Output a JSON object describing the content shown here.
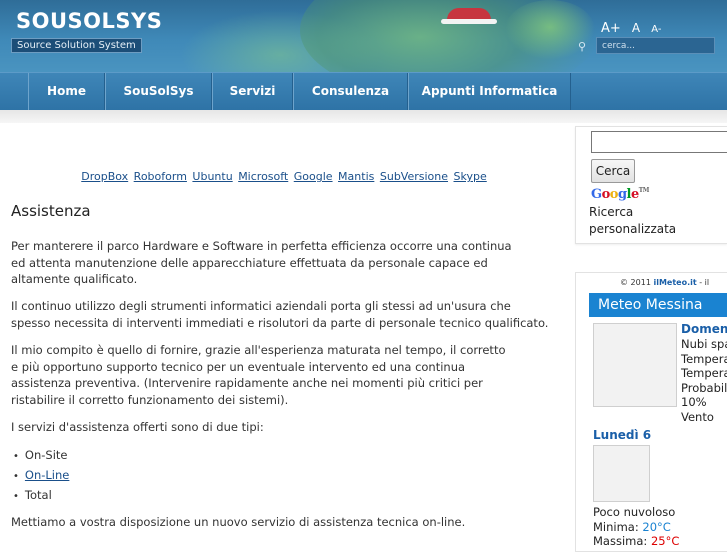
{
  "header": {
    "site_title": "SOUSOLSYS",
    "tagline": "Source Solution System",
    "font_tools": {
      "increase": "A+",
      "normal": "A",
      "decrease": "A-"
    },
    "search_placeholder": "cerca..."
  },
  "nav": {
    "items": [
      {
        "label": "Home"
      },
      {
        "label": "SouSolSys"
      },
      {
        "label": "Servizi"
      },
      {
        "label": "Consulenza"
      },
      {
        "label": "Appunti Informatica"
      }
    ]
  },
  "tags": [
    "DropBox",
    "Roboform",
    "Ubuntu",
    "Microsoft",
    "Google",
    "Mantis",
    "SubVersione",
    "Skype"
  ],
  "article": {
    "title": "Assistenza",
    "paragraphs": [
      [
        "Per manterere il parco Hardware e Software in perfetta efficienza occorre una continua",
        "ed attenta manutenzione delle apparecchiature effettuata da personale capace ed",
        "altamente qualificato."
      ],
      [
        "Il continuo utilizzo degli strumenti informatici aziendali porta gli stessi ad un'usura che",
        "spesso necessita di interventi immediati e risolutori da parte di personale tecnico qualificato."
      ],
      [
        "Il mio compito è quello di fornire, grazie all'esperienza maturata nel tempo, il corretto",
        "e più opportuno supporto tecnico per un eventuale intervento ed una continua",
        "assistenza preventiva. (Intervenire rapidamente anche nei momenti più critici per",
        "ristabilire il corretto funzionamento dei sistemi)."
      ],
      [
        "I servizi d'assistenza offerti sono di due tipi:"
      ]
    ],
    "services": [
      "On-Site",
      "On-Line",
      "Total"
    ],
    "closing": "Mettiamo a vostra disposizione un nuovo servizio di assistenza tecnica on-line."
  },
  "sidebar": {
    "search_button": "Cerca",
    "google_logo": "Google",
    "custom_label": "Ricerca personalizzata",
    "meteo": {
      "credit_prefix": "© 2011",
      "credit_brand": "ilMeteo.it",
      "credit_suffix": "- il",
      "title": "Meteo Messina",
      "day1": {
        "name": "Domenica",
        "lines": [
          "Nubi sparse",
          "Temperatura",
          "Temperatura",
          "Probabilità",
          "10%",
          "Vento"
        ]
      },
      "day2": {
        "name": "Lunedì 6",
        "condition": "Poco nuvoloso",
        "min_label": "Minima:",
        "min_value": "20°C",
        "max_label": "Massima:",
        "max_value": "25°C"
      }
    }
  }
}
